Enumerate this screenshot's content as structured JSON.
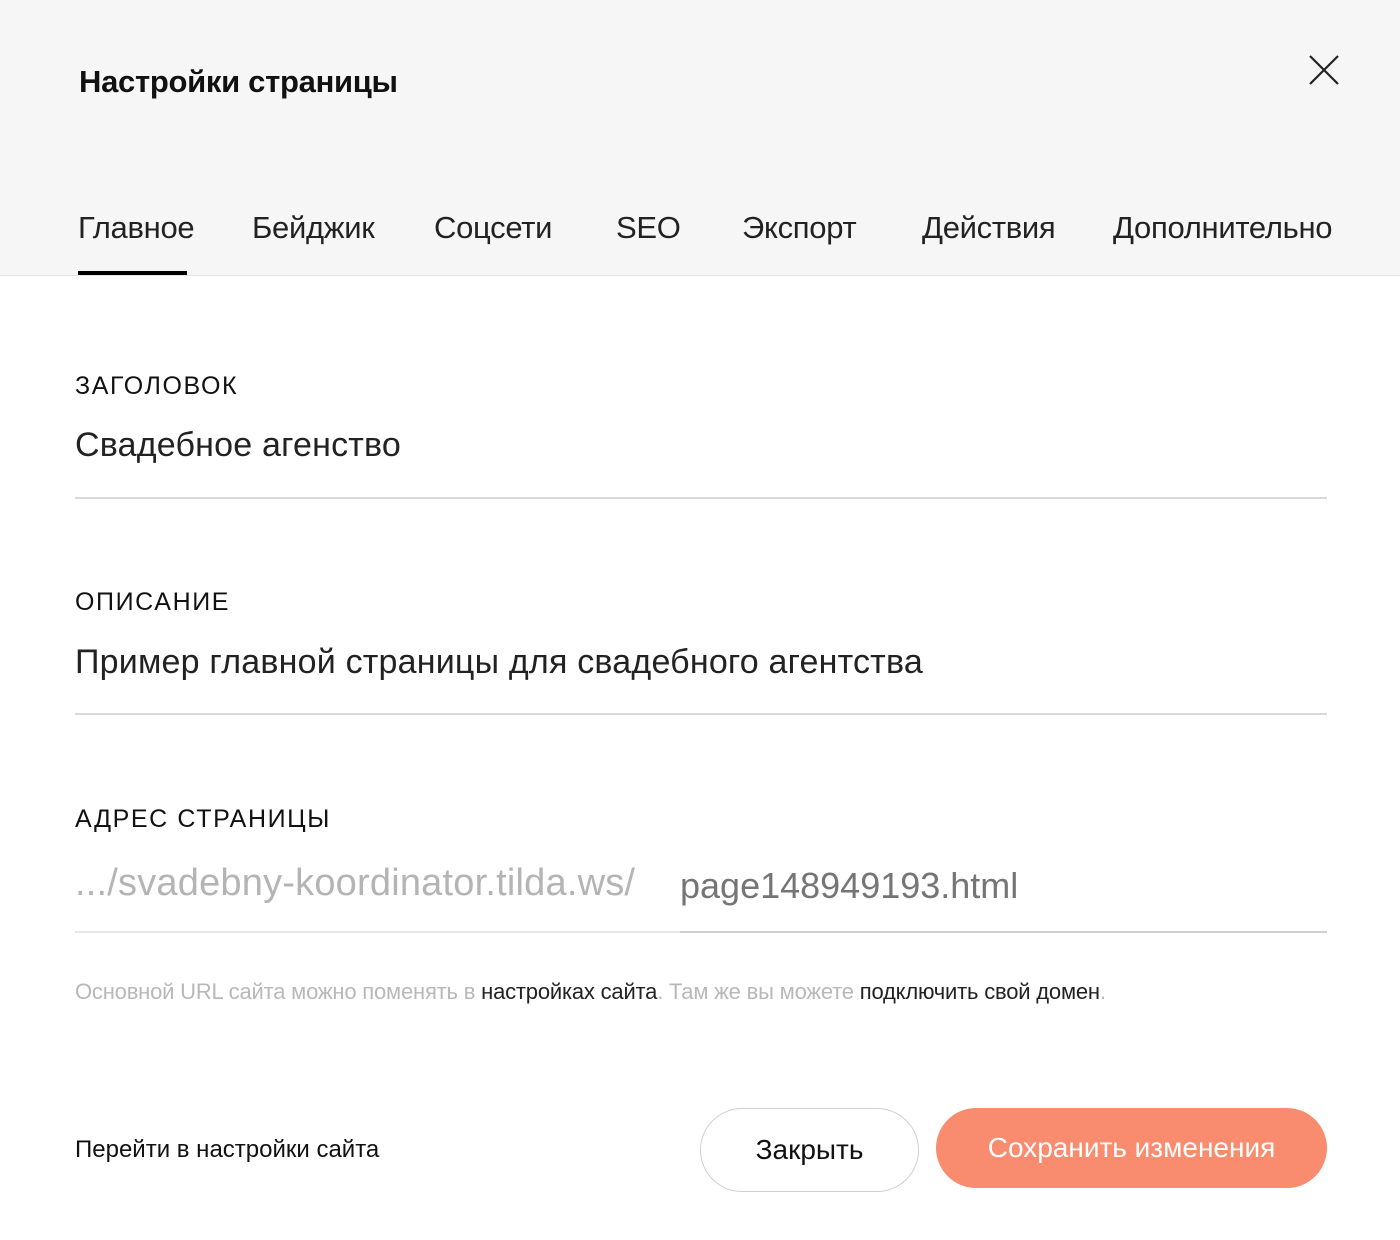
{
  "header": {
    "title": "Настройки страницы",
    "close_icon": "close-icon"
  },
  "tabs": [
    {
      "label": "Главное",
      "active": true
    },
    {
      "label": "Бейджик",
      "active": false
    },
    {
      "label": "Соцсети",
      "active": false
    },
    {
      "label": "SEO",
      "active": false
    },
    {
      "label": "Экспорт",
      "active": false
    },
    {
      "label": "Действия",
      "active": false
    },
    {
      "label": "Дополнительно",
      "active": false
    }
  ],
  "fields": {
    "title": {
      "label": "ЗАГОЛОВОК",
      "value": "Свадебное агенство"
    },
    "description": {
      "label": "ОПИСАНИЕ",
      "value": "Пример главной страницы для свадебного агентства"
    },
    "address": {
      "label": "АДРЕС СТРАНИЦЫ",
      "prefix": ".../svadebny-koordinator.tilda.ws/",
      "placeholder": "page148949193.html"
    }
  },
  "hint": {
    "part1": "Основной URL сайта можно поменять в ",
    "link1": "настройках сайта",
    "part2": ". Там же вы можете ",
    "link2": "подключить свой домен",
    "part3": "."
  },
  "footer": {
    "site_settings_link": "Перейти в настройки сайта",
    "close_label": "Закрыть",
    "save_label": "Сохранить изменения"
  },
  "colors": {
    "accent": "#f98b6e",
    "header_bg": "#f6f6f6"
  }
}
